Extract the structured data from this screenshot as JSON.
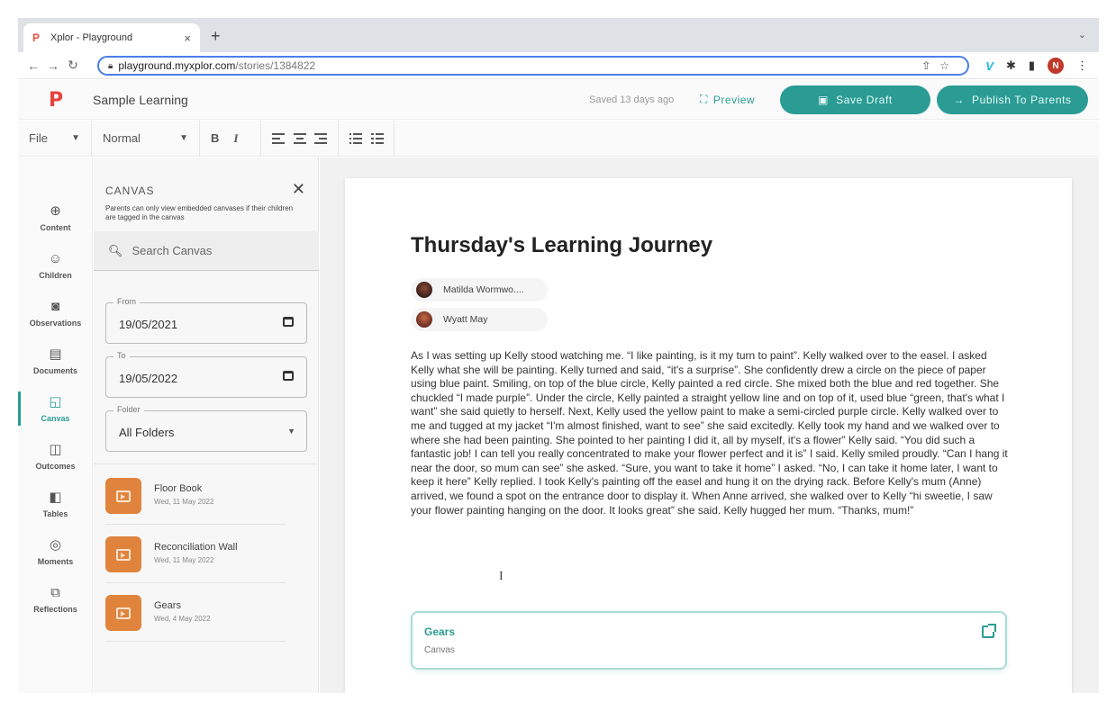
{
  "browser": {
    "tab_title": "Xplor - Playground",
    "tab_close": "×",
    "new_tab": "+",
    "url_host": "playground.myxplor.com",
    "url_path": "/stories/1384822",
    "profile_initial": "N"
  },
  "header": {
    "doc_title": "Sample Learning",
    "saved_text": "Saved 13 days ago",
    "preview_label": "Preview",
    "save_draft_label": "Save Draft",
    "publish_label": "Publish To Parents"
  },
  "toolbar": {
    "file_label": "File",
    "style_label": "Normal",
    "bold_label": "B",
    "italic_label": "I"
  },
  "nav": {
    "items": [
      {
        "label": "Content",
        "icon": "content-icon"
      },
      {
        "label": "Children",
        "icon": "children-icon"
      },
      {
        "label": "Observations",
        "icon": "camera-icon"
      },
      {
        "label": "Documents",
        "icon": "documents-icon"
      },
      {
        "label": "Canvas",
        "icon": "canvas-icon"
      },
      {
        "label": "Outcomes",
        "icon": "outcomes-icon"
      },
      {
        "label": "Tables",
        "icon": "tables-icon"
      },
      {
        "label": "Moments",
        "icon": "moments-icon"
      },
      {
        "label": "Reflections",
        "icon": "reflections-icon"
      }
    ],
    "active": "Canvas"
  },
  "canvas_panel": {
    "title": "CANVAS",
    "note": "Parents can only view embedded canvases if their children are tagged in the canvas",
    "search_placeholder": "Search Canvas",
    "from_label": "From",
    "from_value": "19/05/2021",
    "to_label": "To",
    "to_value": "19/05/2022",
    "folder_label": "Folder",
    "folder_value": "All Folders",
    "items": [
      {
        "name": "Floor Book",
        "date": "Wed, 11 May 2022"
      },
      {
        "name": "Reconciliation Wall",
        "date": "Wed, 11 May 2022"
      },
      {
        "name": "Gears",
        "date": "Wed, 4 May 2022"
      }
    ]
  },
  "story": {
    "heading": "Thursday's Learning Journey",
    "children": [
      "Matilda Wormwo....",
      "Wyatt May"
    ],
    "body": "As I was setting up Kelly stood watching me. “I like painting, is it my turn to paint”. Kelly walked over to the easel. I asked Kelly what she will be painting. Kelly turned and said, “it's a surprise”. She confidently drew a circle on the piece of paper using blue paint. Smiling, on top of the blue circle, Kelly painted a red circle. She mixed both the blue and red together. She chuckled “I made purple”. Under the circle, Kelly painted a straight yellow line and on top of it, used blue “green, that's what I want” she said quietly to herself. Next, Kelly used the yellow paint to make a semi-circled purple circle. Kelly walked over to me and tugged at my jacket “I'm almost finished, want to see” she said excitedly. Kelly took my hand and we walked over to where she had been painting. She pointed to her painting I did it, all by myself, it's a flower” Kelly said. “You did such a fantastic job! I can tell you really concentrated to make your flower perfect and it is” I said. Kelly smiled proudly. “Can I hang it near the door, so mum can see” she asked. “Sure, you want to take it home” I asked. “No, I can take it home later, I want to keep it here” Kelly replied. I took Kelly's painting off the easel and hung it on the drying rack. Before Kelly's mum (Anne) arrived, we found a spot on the entrance door to display it. When Anne arrived, she walked over to Kelly “hi sweetie, I saw your flower painting hanging on the door. It looks great” she said. Kelly hugged her mum. “Thanks, mum!”",
    "embed": {
      "title": "Gears",
      "subtitle": "Canvas"
    }
  },
  "colors": {
    "accent": "#2a9c94",
    "brand": "#e8433e",
    "canvas_thumb": "#e0843d"
  }
}
